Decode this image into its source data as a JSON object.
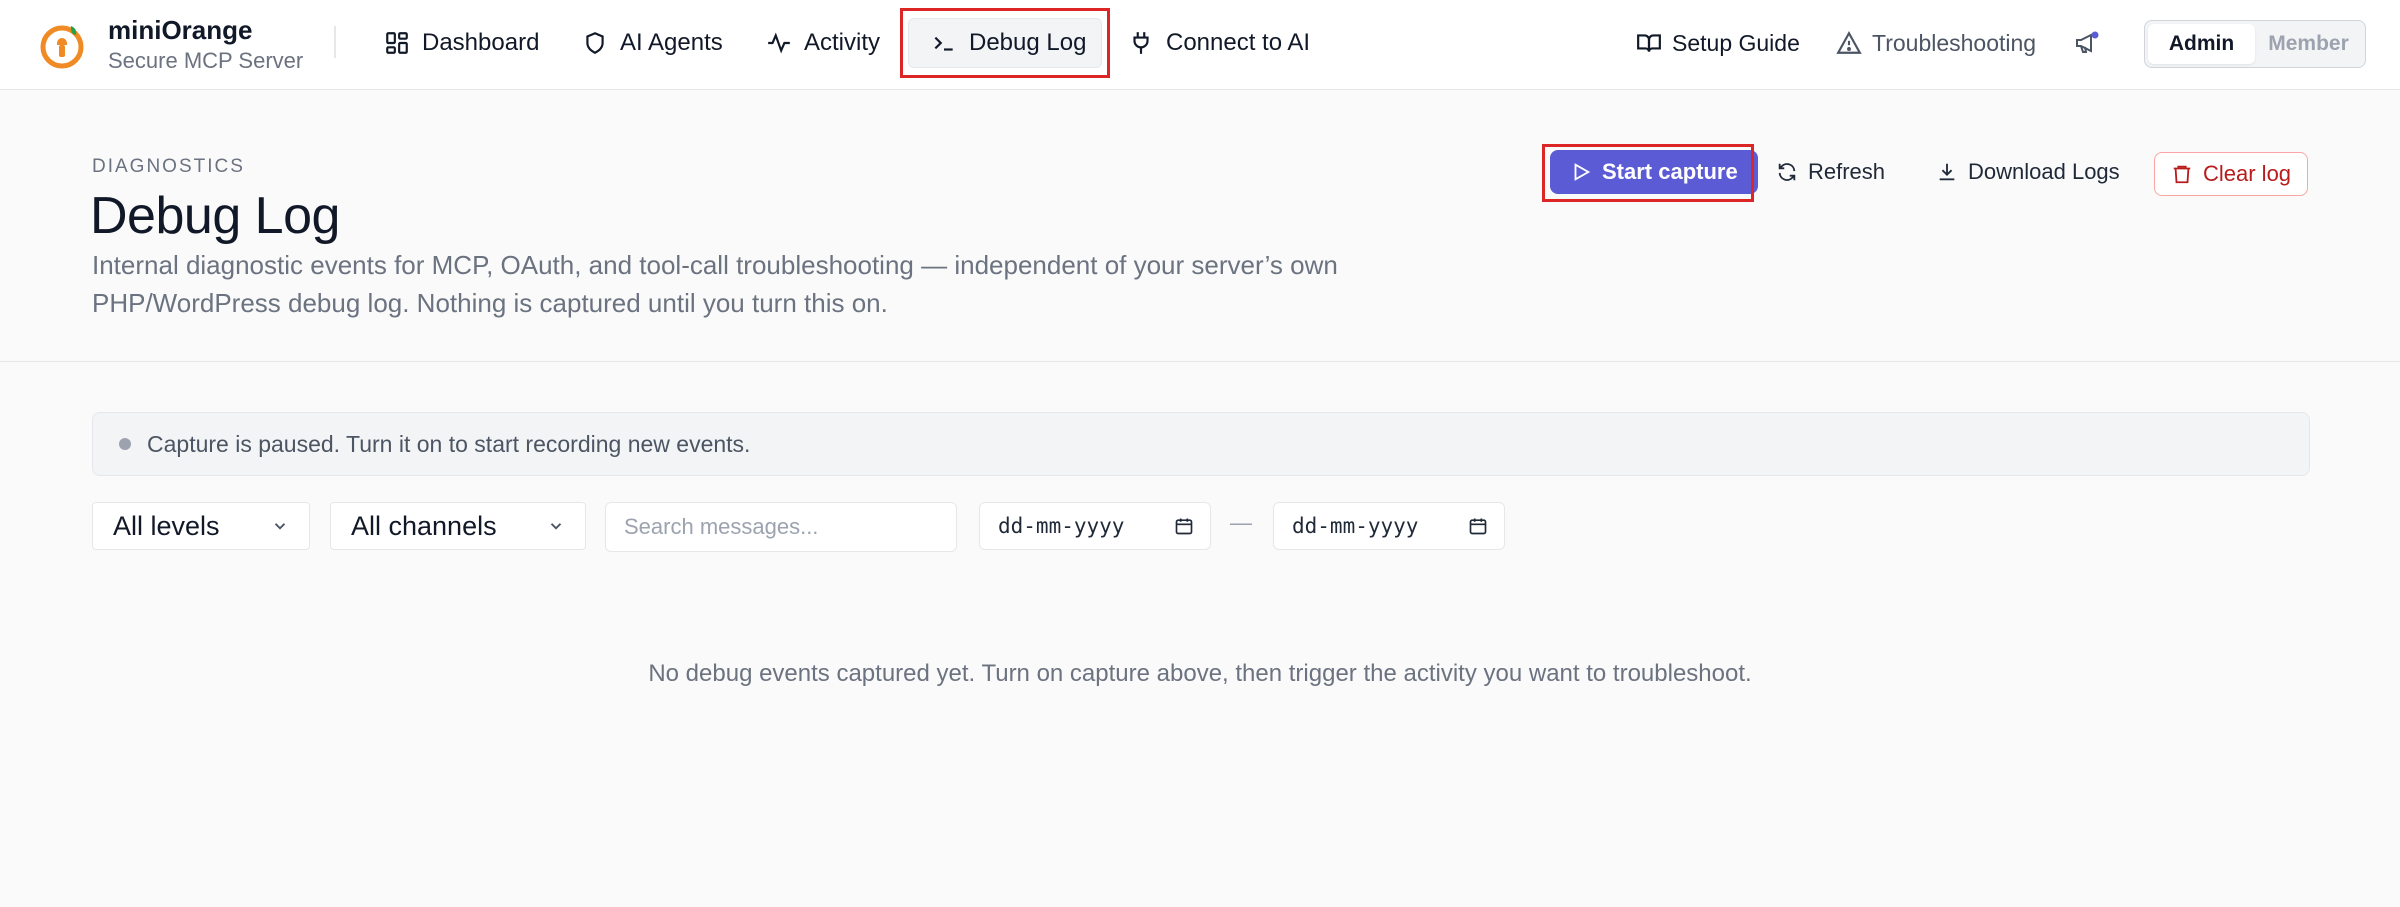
{
  "brand": {
    "name": "miniOrange",
    "subtitle": "Secure MCP Server"
  },
  "nav": {
    "items": [
      {
        "label": "Dashboard",
        "icon": "dashboard-grid-icon"
      },
      {
        "label": "AI Agents",
        "icon": "shield-icon"
      },
      {
        "label": "Activity",
        "icon": "activity-pulse-icon"
      },
      {
        "label": "Debug Log",
        "icon": "terminal-icon",
        "active": true
      },
      {
        "label": "Connect to AI",
        "icon": "plug-icon"
      }
    ]
  },
  "right_nav": {
    "setup_guide": "Setup Guide",
    "troubleshooting": "Troubleshooting",
    "announcement_icon": "megaphone-icon"
  },
  "role_toggle": {
    "admin": "Admin",
    "member": "Member",
    "selected": "Admin"
  },
  "header": {
    "eyebrow": "DIAGNOSTICS",
    "title": "Debug Log",
    "description": "Internal diagnostic events for MCP, OAuth, and tool-call troubleshooting — independent of your server’s own PHP/WordPress debug log. Nothing is captured until you turn this on."
  },
  "actions": {
    "start_capture": "Start capture",
    "refresh": "Refresh",
    "download_logs": "Download Logs",
    "clear_log": "Clear log"
  },
  "notice": {
    "text": "Capture is paused. Turn it on to start recording new events."
  },
  "filters": {
    "level": "All levels",
    "channel": "All channels",
    "search_placeholder": "Search messages...",
    "date_from": "dd-mm-yyyy",
    "date_to": "dd-mm-yyyy",
    "date_separator": "—"
  },
  "empty_state": {
    "text": "No debug events captured yet. Turn on capture above, then trigger the activity you want to troubleshoot."
  },
  "colors": {
    "primary": "#5b5bd6",
    "danger": "#b91c1c",
    "brand_orange": "#f08a24",
    "highlight": "#dc2626"
  }
}
